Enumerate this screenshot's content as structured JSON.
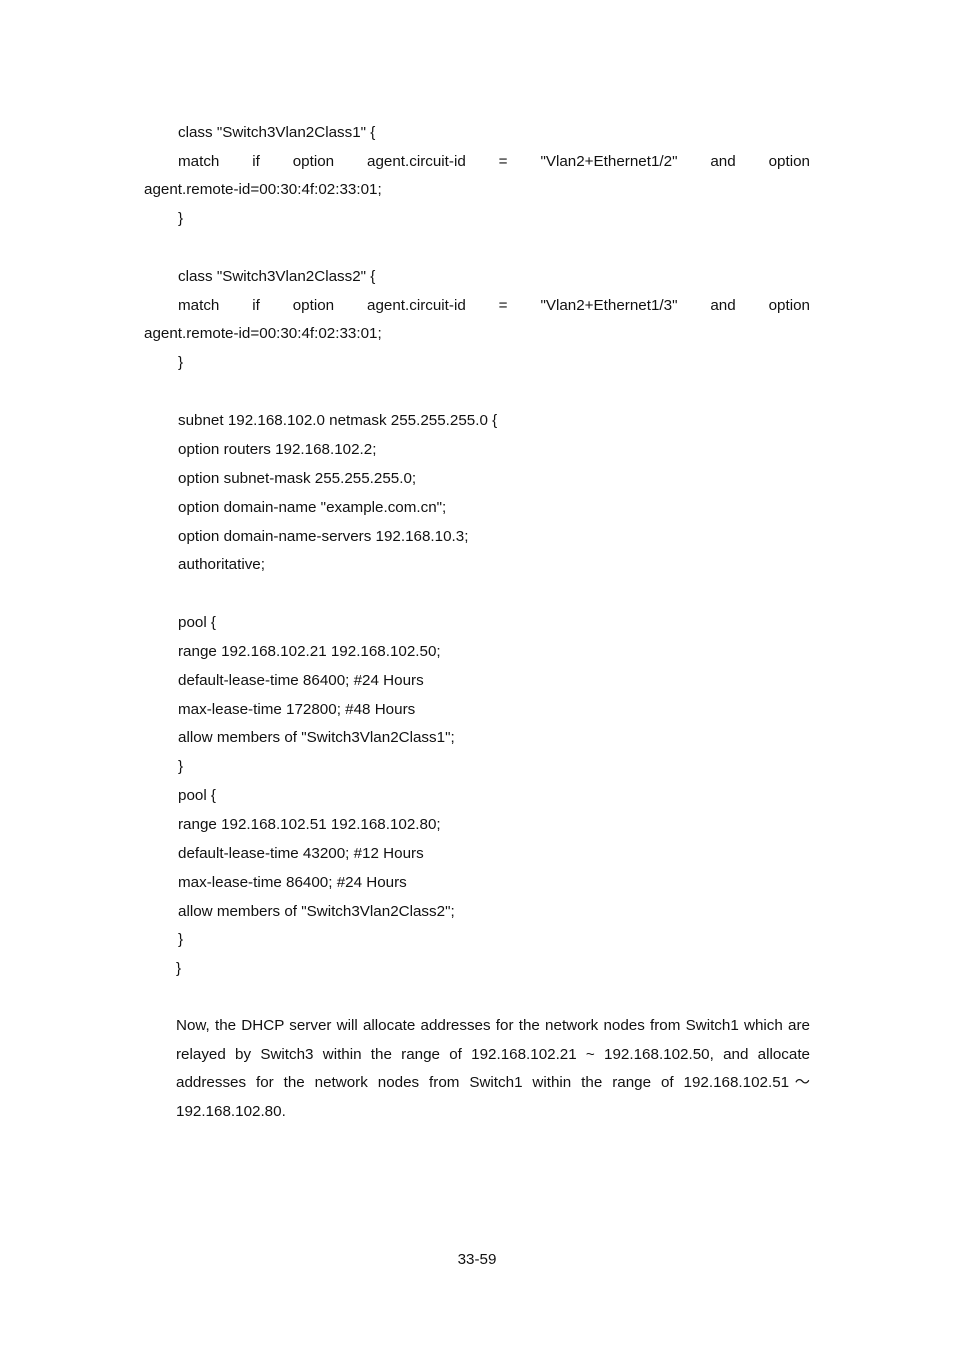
{
  "class1": {
    "open": "class \"Switch3Vlan2Class1\" {",
    "match_words": [
      "match",
      "if",
      "option",
      "agent.circuit-id",
      "=",
      "\"Vlan2+Ethernet1/2\"",
      "and",
      "option"
    ],
    "match_cont": "agent.remote-id=00:30:4f:02:33:01;",
    "close": "}"
  },
  "class2": {
    "open": "class \"Switch3Vlan2Class2\" {",
    "match_words": [
      "match",
      "if",
      "option",
      "agent.circuit-id",
      "=",
      "\"Vlan2+Ethernet1/3\"",
      "and",
      "option"
    ],
    "match_cont": "agent.remote-id=00:30:4f:02:33:01;",
    "close": "}"
  },
  "subnet": {
    "lines": [
      "subnet 192.168.102.0 netmask 255.255.255.0 {",
      "option routers 192.168.102.2;",
      "option subnet-mask 255.255.255.0;",
      "option domain-name \"example.com.cn\";",
      "option domain-name-servers 192.168.10.3;",
      "authoritative;"
    ]
  },
  "pool1": {
    "lines": [
      "pool {",
      "range 192.168.102.21 192.168.102.50;",
      "default-lease-time 86400; #24 Hours",
      "max-lease-time 172800; #48 Hours",
      "allow members of \"Switch3Vlan2Class1\";",
      "}"
    ]
  },
  "pool2": {
    "lines": [
      "pool {",
      "range 192.168.102.51 192.168.102.80;",
      "default-lease-time 43200; #12 Hours",
      "max-lease-time 86400; #24 Hours",
      "allow members of \"Switch3Vlan2Class2\";",
      "}",
      "}"
    ]
  },
  "summary": "Now, the DHCP server will allocate addresses for the network nodes from Switch1 which are relayed by Switch3 within the range of 192.168.102.21 ~ 192.168.102.50, and allocate addresses for the network nodes from Switch1 within the range of 192.168.102.51～192.168.102.80.",
  "page_number": "33-59"
}
